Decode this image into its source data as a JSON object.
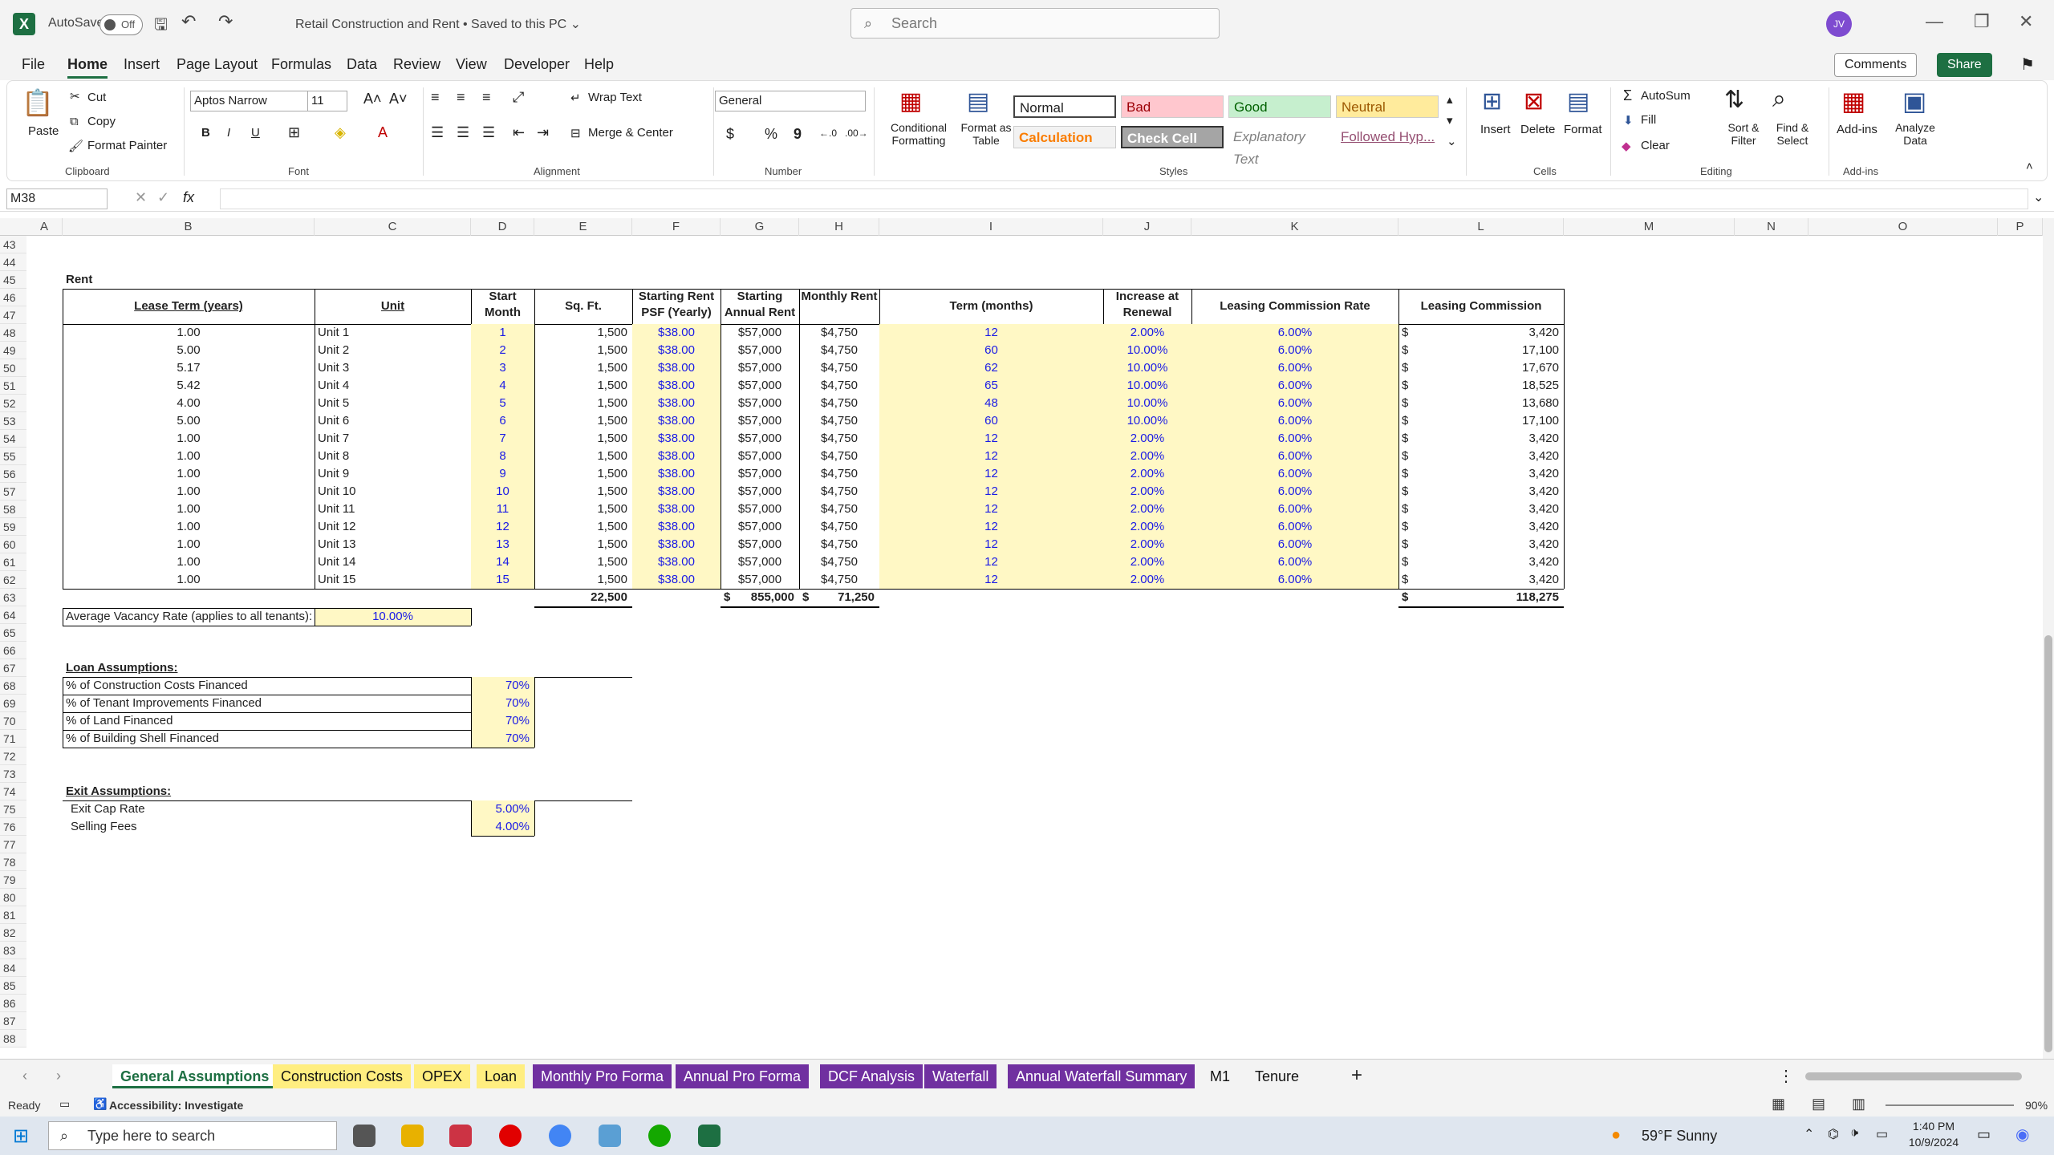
{
  "titlebar": {
    "autosave": "AutoSave",
    "toggle": "Off",
    "doc_title": "Retail Construction and Rent • Saved to this PC ⌄",
    "search_placeholder": "Search",
    "avatar": "JV"
  },
  "menu": [
    "File",
    "Home",
    "Insert",
    "Page Layout",
    "Formulas",
    "Data",
    "Review",
    "View",
    "Developer",
    "Help"
  ],
  "menu_active": "Home",
  "top_buttons": {
    "comments": "Comments",
    "share": "Share"
  },
  "ribbon": {
    "clipboard": {
      "paste": "Paste",
      "cut": "Cut",
      "copy": "Copy",
      "format_painter": "Format Painter",
      "group": "Clipboard"
    },
    "font": {
      "name": "Aptos Narrow",
      "size": "11",
      "group": "Font",
      "bold": "B",
      "italic": "I",
      "underline": "U"
    },
    "alignment": {
      "wrap": "Wrap Text",
      "merge": "Merge & Center",
      "group": "Alignment"
    },
    "number": {
      "format": "General",
      "group": "Number",
      "currency": "$",
      "percent": "%",
      "comma": "9"
    },
    "styles": {
      "conditional": "Conditional Formatting",
      "format_table": "Format as Table",
      "normal": "Normal",
      "bad": "Bad",
      "good": "Good",
      "neutral": "Neutral",
      "calculation": "Calculation",
      "check": "Check Cell",
      "explanatory": "Explanatory Text",
      "followed": "Followed Hyp...",
      "group": "Styles"
    },
    "cells": {
      "insert": "Insert",
      "delete": "Delete",
      "format": "Format",
      "group": "Cells"
    },
    "editing": {
      "autosum": "AutoSum",
      "fill": "Fill",
      "clear": "Clear",
      "sort": "Sort & Filter",
      "find": "Find & Select",
      "group": "Editing"
    },
    "addins": {
      "addins": "Add-ins",
      "analyze": "Analyze Data",
      "group": "Add-ins"
    }
  },
  "namebox": "M38",
  "columns": [
    "A",
    "B",
    "C",
    "D",
    "E",
    "F",
    "G",
    "H",
    "I",
    "J",
    "K",
    "L",
    "M",
    "N",
    "O",
    "P"
  ],
  "rows_start": 43,
  "rows_end": 88,
  "rent": {
    "title": "Rent",
    "headers": [
      "Lease Term (years)",
      "Unit",
      "Start Month",
      "Sq. Ft.",
      "Starting Rent PSF (Yearly)",
      "Starting Annual Rent",
      "Monthly Rent",
      "Term (months)",
      "Increase at Renewal",
      "Leasing Commission Rate",
      "Leasing Commission"
    ],
    "rows": [
      [
        "1.00",
        "Unit 1",
        "1",
        "1,500",
        "$38.00",
        "$57,000",
        "$4,750",
        "12",
        "2.00%",
        "6.00%",
        "$",
        "3,420"
      ],
      [
        "5.00",
        "Unit 2",
        "2",
        "1,500",
        "$38.00",
        "$57,000",
        "$4,750",
        "60",
        "10.00%",
        "6.00%",
        "$",
        "17,100"
      ],
      [
        "5.17",
        "Unit 3",
        "3",
        "1,500",
        "$38.00",
        "$57,000",
        "$4,750",
        "62",
        "10.00%",
        "6.00%",
        "$",
        "17,670"
      ],
      [
        "5.42",
        "Unit 4",
        "4",
        "1,500",
        "$38.00",
        "$57,000",
        "$4,750",
        "65",
        "10.00%",
        "6.00%",
        "$",
        "18,525"
      ],
      [
        "4.00",
        "Unit 5",
        "5",
        "1,500",
        "$38.00",
        "$57,000",
        "$4,750",
        "48",
        "10.00%",
        "6.00%",
        "$",
        "13,680"
      ],
      [
        "5.00",
        "Unit 6",
        "6",
        "1,500",
        "$38.00",
        "$57,000",
        "$4,750",
        "60",
        "10.00%",
        "6.00%",
        "$",
        "17,100"
      ],
      [
        "1.00",
        "Unit 7",
        "7",
        "1,500",
        "$38.00",
        "$57,000",
        "$4,750",
        "12",
        "2.00%",
        "6.00%",
        "$",
        "3,420"
      ],
      [
        "1.00",
        "Unit 8",
        "8",
        "1,500",
        "$38.00",
        "$57,000",
        "$4,750",
        "12",
        "2.00%",
        "6.00%",
        "$",
        "3,420"
      ],
      [
        "1.00",
        "Unit 9",
        "9",
        "1,500",
        "$38.00",
        "$57,000",
        "$4,750",
        "12",
        "2.00%",
        "6.00%",
        "$",
        "3,420"
      ],
      [
        "1.00",
        "Unit 10",
        "10",
        "1,500",
        "$38.00",
        "$57,000",
        "$4,750",
        "12",
        "2.00%",
        "6.00%",
        "$",
        "3,420"
      ],
      [
        "1.00",
        "Unit 11",
        "11",
        "1,500",
        "$38.00",
        "$57,000",
        "$4,750",
        "12",
        "2.00%",
        "6.00%",
        "$",
        "3,420"
      ],
      [
        "1.00",
        "Unit 12",
        "12",
        "1,500",
        "$38.00",
        "$57,000",
        "$4,750",
        "12",
        "2.00%",
        "6.00%",
        "$",
        "3,420"
      ],
      [
        "1.00",
        "Unit 13",
        "13",
        "1,500",
        "$38.00",
        "$57,000",
        "$4,750",
        "12",
        "2.00%",
        "6.00%",
        "$",
        "3,420"
      ],
      [
        "1.00",
        "Unit 14",
        "14",
        "1,500",
        "$38.00",
        "$57,000",
        "$4,750",
        "12",
        "2.00%",
        "6.00%",
        "$",
        "3,420"
      ],
      [
        "1.00",
        "Unit 15",
        "15",
        "1,500",
        "$38.00",
        "$57,000",
        "$4,750",
        "12",
        "2.00%",
        "6.00%",
        "$",
        "3,420"
      ]
    ],
    "totals": {
      "sqft": "22,500",
      "annual_cur": "$",
      "annual": "855,000",
      "monthly_cur": "$",
      "monthly": "71,250",
      "commission_cur": "$",
      "commission": "118,275"
    },
    "vacancy_label": "Average Vacancy Rate (applies to all tenants):",
    "vacancy_value": "10.00%"
  },
  "loan": {
    "title": "Loan Assumptions:",
    "rows": [
      [
        "% of Construction Costs Financed",
        "70%"
      ],
      [
        "% of Tenant Improvements Financed",
        "70%"
      ],
      [
        "% of Land Financed",
        "70%"
      ],
      [
        "% of Building Shell Financed",
        "70%"
      ]
    ]
  },
  "exit": {
    "title": "Exit Assumptions:",
    "rows": [
      [
        "Exit Cap Rate",
        "5.00%"
      ],
      [
        "Selling Fees",
        "4.00%"
      ]
    ]
  },
  "sheets": [
    {
      "name": "General Assumptions",
      "style": "active"
    },
    {
      "name": "Construction Costs",
      "style": "yellow"
    },
    {
      "name": "OPEX",
      "style": "yellow"
    },
    {
      "name": "Loan",
      "style": "yellow"
    },
    {
      "name": "Monthly Pro Forma",
      "style": "purple"
    },
    {
      "name": "Annual Pro Forma",
      "style": "purple"
    },
    {
      "name": "DCF Analysis",
      "style": "purple"
    },
    {
      "name": "Waterfall",
      "style": "purple"
    },
    {
      "name": "Annual Waterfall Summary",
      "style": "purple"
    },
    {
      "name": "M1",
      "style": "plain"
    },
    {
      "name": "Tenure",
      "style": "plain"
    }
  ],
  "status": {
    "ready": "Ready",
    "accessibility": "Accessibility: Investigate",
    "zoom": "90%"
  },
  "taskbar": {
    "search": "Type here to search",
    "weather": "59°F  Sunny",
    "time": "1:40 PM",
    "date": "10/9/2024"
  }
}
